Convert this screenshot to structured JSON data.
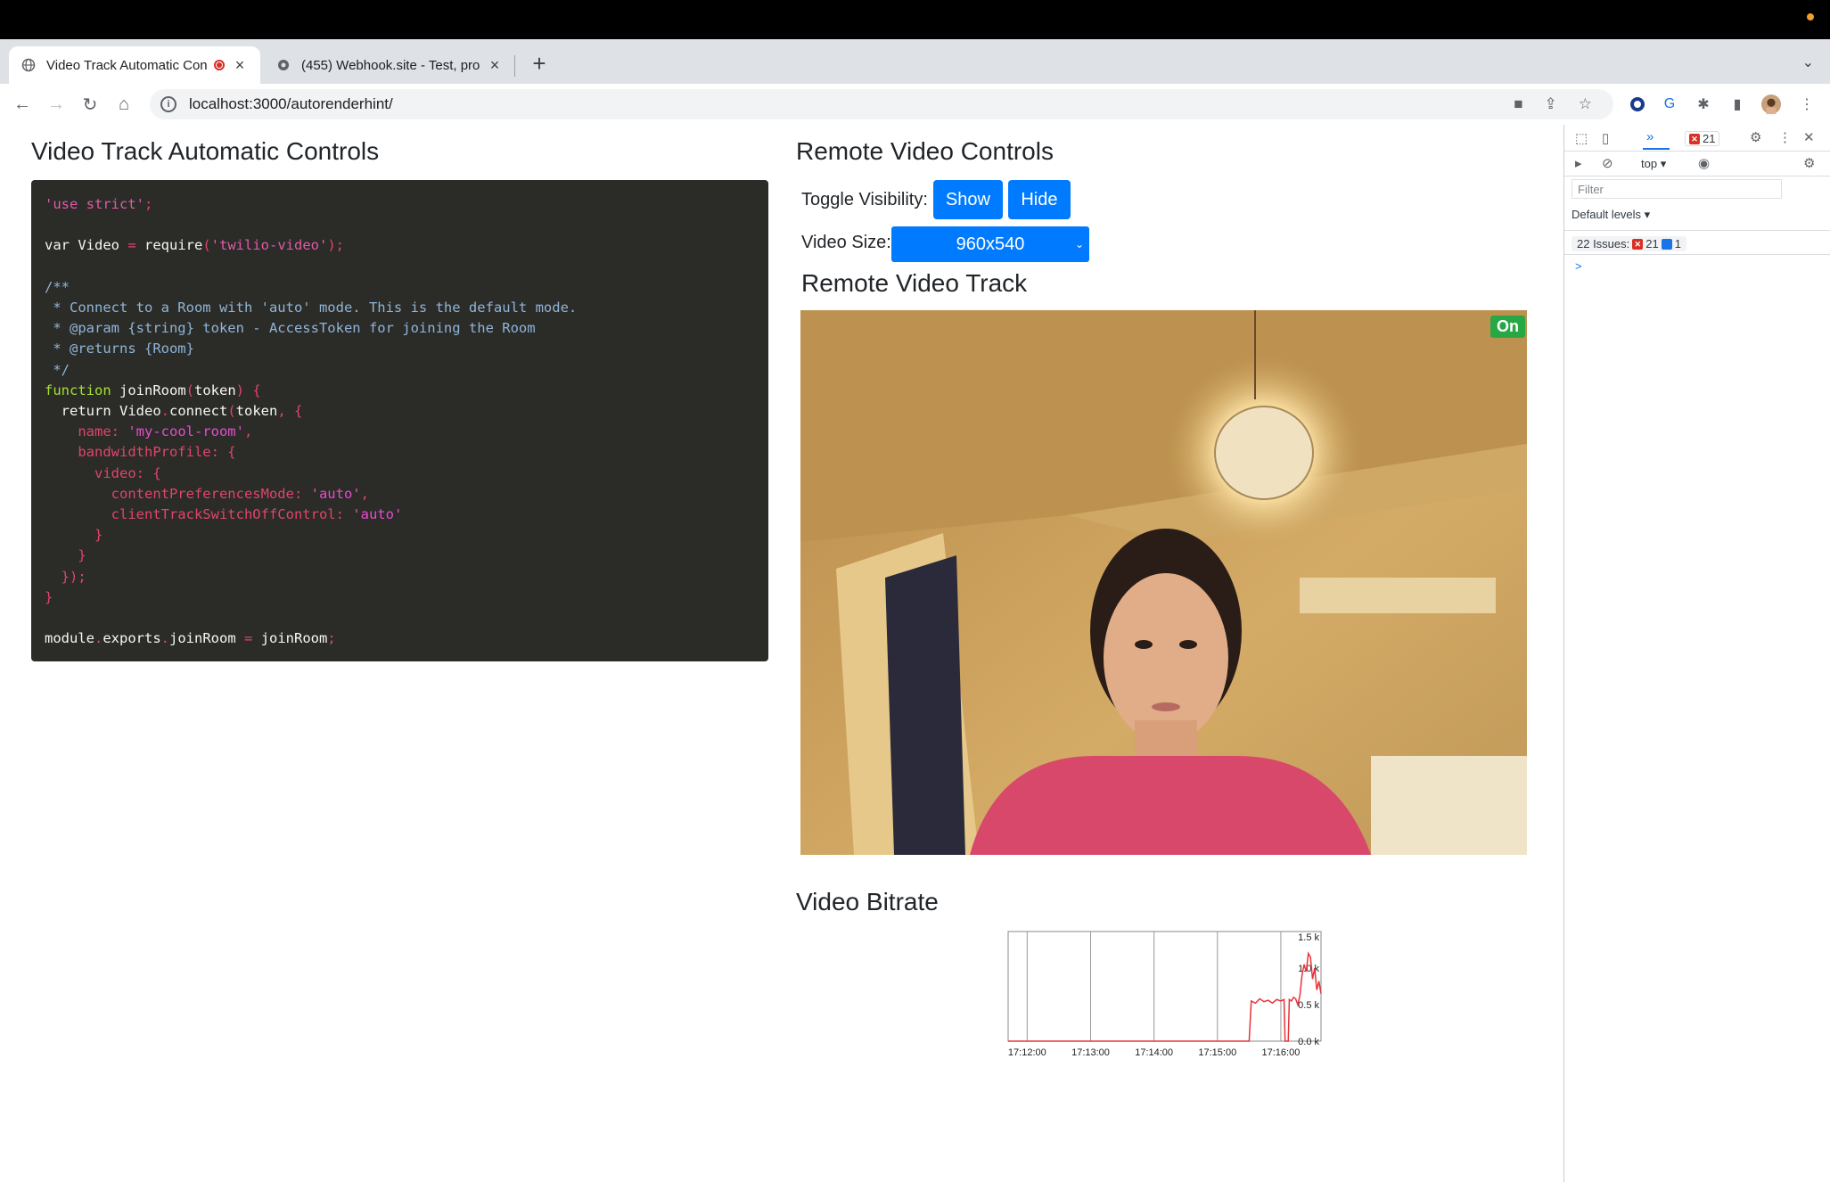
{
  "browser": {
    "tabs": [
      {
        "title": "Video Track Automatic Con",
        "close": "×"
      },
      {
        "title": "(455) Webhook.site - Test, pro",
        "close": "×"
      }
    ],
    "new_tab": "+",
    "url": "localhost:3000/autorenderhint/"
  },
  "left": {
    "heading": "Video Track Automatic Controls"
  },
  "right": {
    "heading": "Remote Video Controls",
    "toggle_label": "Toggle Visibility:",
    "show_label": "Show",
    "hide_label": "Hide",
    "size_label": "Video Size:",
    "size_value": "960x540",
    "track_heading": "Remote Video Track",
    "on_badge": "On",
    "bitrate_heading": "Video Bitrate"
  },
  "chart_data": {
    "type": "line",
    "title": "",
    "x_ticks": [
      "17:12:00",
      "17:13:00",
      "17:14:00",
      "17:15:00",
      "17:16:00"
    ],
    "y_ticks": [
      "0.0 k",
      "0.5 k",
      "1.0 k",
      "1.5 k"
    ],
    "ylim": [
      0,
      1.5
    ],
    "series": [
      {
        "color": "#e8333a",
        "x": [
          "17:11:42",
          "17:12:00",
          "17:13:00",
          "17:14:00",
          "17:15:00",
          "17:15:30",
          "17:15:32",
          "17:15:36",
          "17:15:40",
          "17:15:44",
          "17:15:48",
          "17:15:52",
          "17:15:56",
          "17:16:00",
          "17:16:03",
          "17:16:04",
          "17:16:07",
          "17:16:08",
          "17:16:10",
          "17:16:12",
          "17:16:14",
          "17:16:16",
          "17:16:18",
          "17:16:20",
          "17:16:22",
          "17:16:24",
          "17:16:26",
          "17:16:28",
          "17:16:30",
          "17:16:32",
          "17:16:34",
          "17:16:36",
          "17:16:38"
        ],
        "y": [
          0,
          0,
          0,
          0,
          0,
          0,
          0.55,
          0.52,
          0.58,
          0.54,
          0.56,
          0.52,
          0.57,
          0.55,
          0.57,
          0,
          0,
          0.57,
          0.55,
          0.6,
          0.58,
          0.5,
          0.62,
          0.9,
          1.05,
          0.95,
          1.2,
          1.15,
          0.85,
          1.0,
          0.7,
          0.82,
          0.65
        ]
      }
    ]
  },
  "devtools": {
    "error_count": "21",
    "context": "top",
    "filter_placeholder": "Filter",
    "levels": "Default levels",
    "issues_label": "22 Issues:",
    "issues_errors": "21",
    "issues_info": "1",
    "prompt": ">"
  },
  "code": [
    [
      [
        "str",
        "'use strict'"
      ],
      [
        "pun",
        ";"
      ]
    ],
    [],
    [
      [
        "var",
        "var Video "
      ],
      [
        "pun",
        "= "
      ],
      [
        "var",
        "require"
      ],
      [
        "pun",
        "("
      ],
      [
        "str",
        "'twilio-video'"
      ],
      [
        "pun",
        ");"
      ]
    ],
    [],
    [
      [
        "cm",
        "/**"
      ]
    ],
    [
      [
        "cm",
        " * Connect to a Room with 'auto' mode. This is the default mode."
      ]
    ],
    [
      [
        "cm",
        " * @param {string} token - AccessToken for joining the Room"
      ]
    ],
    [
      [
        "cm",
        " * @returns {Room}"
      ]
    ],
    [
      [
        "cm",
        " */"
      ]
    ],
    [
      [
        "fn",
        "function "
      ],
      [
        "var",
        "joinRoom"
      ],
      [
        "pun",
        "("
      ],
      [
        "var",
        "token"
      ],
      [
        "pun",
        ") {"
      ]
    ],
    [
      [
        "var",
        "  return Video"
      ],
      [
        "pun",
        "."
      ],
      [
        "var",
        "connect"
      ],
      [
        "pun",
        "("
      ],
      [
        "var",
        "token"
      ],
      [
        "pun",
        ", {"
      ]
    ],
    [
      [
        "prop",
        "    name: "
      ],
      [
        "val",
        "'my-cool-room'"
      ],
      [
        "pun",
        ","
      ]
    ],
    [
      [
        "prop",
        "    bandwidthProfile: {"
      ]
    ],
    [
      [
        "prop",
        "      video: {"
      ]
    ],
    [
      [
        "prop",
        "        contentPreferencesMode: "
      ],
      [
        "val",
        "'auto'"
      ],
      [
        "pun",
        ","
      ]
    ],
    [
      [
        "prop",
        "        clientTrackSwitchOffControl: "
      ],
      [
        "val",
        "'auto'"
      ]
    ],
    [
      [
        "pun",
        "      }"
      ]
    ],
    [
      [
        "pun",
        "    }"
      ]
    ],
    [
      [
        "pun",
        "  });"
      ]
    ],
    [
      [
        "pun",
        "}"
      ]
    ],
    [],
    [
      [
        "var",
        "module"
      ],
      [
        "pun",
        "."
      ],
      [
        "var",
        "exports"
      ],
      [
        "pun",
        "."
      ],
      [
        "var",
        "joinRoom "
      ],
      [
        "pun",
        "= "
      ],
      [
        "var",
        "joinRoom"
      ],
      [
        "pun",
        ";"
      ]
    ]
  ]
}
